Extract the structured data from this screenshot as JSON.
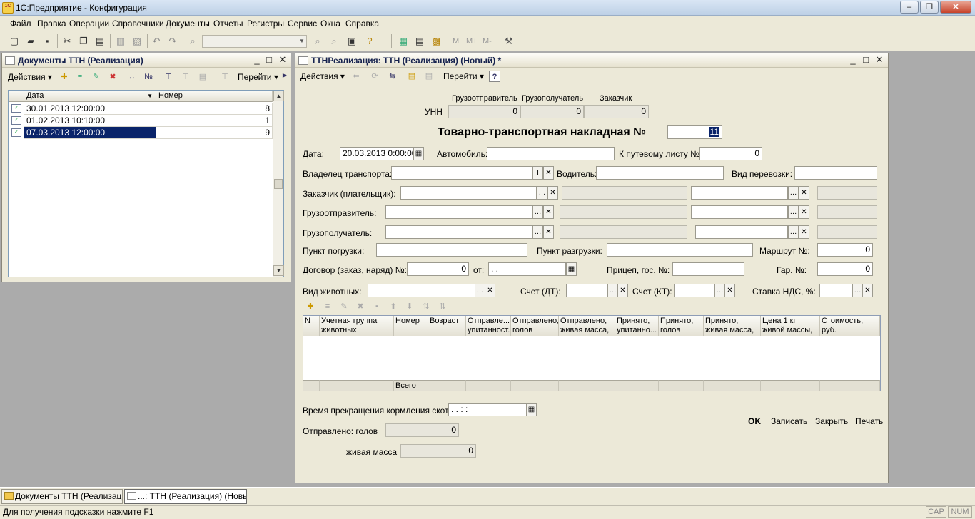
{
  "app": {
    "title": "1С:Предприятие - Конфигурация",
    "logo": "1C"
  },
  "window_controls": {
    "minimize": "–",
    "maximize": "❐",
    "close": "✕"
  },
  "menu": [
    "Файл",
    "Правка",
    "Операции",
    "Справочники",
    "Документы",
    "Отчеты",
    "Регистры",
    "Сервис",
    "Окна",
    "Справка"
  ],
  "toolbar": {
    "search_value": "",
    "right_labels": [
      "M",
      "M+",
      "M-"
    ]
  },
  "list_window": {
    "title": "Документы ТТН (Реализация)",
    "actions_label": "Действия",
    "goto_label": "Перейти",
    "columns": [
      "Дата",
      "Номер"
    ],
    "rows": [
      {
        "date": "30.01.2013 12:00:00",
        "number": "8"
      },
      {
        "date": "01.02.2013 10:10:00",
        "number": "1"
      },
      {
        "date": "07.03.2013 12:00:00",
        "number": "9"
      }
    ]
  },
  "form_window": {
    "title": "ТТНРеализация: ТТН (Реализация) (Новый) *",
    "actions_label": "Действия",
    "goto_label": "Перейти",
    "help_label": "?",
    "unn": {
      "label": "УНН",
      "headers": [
        "Грузоотправитель",
        "Грузополучатель",
        "Заказчик"
      ],
      "values": [
        "0",
        "0",
        "0"
      ]
    },
    "doc_title": "Товарно-транспортная накладная №",
    "doc_number": "11",
    "date_label": "Дата:",
    "date_value": "20.03.2013  0:00:00",
    "car_label": "Автомобиль:",
    "car_value": "",
    "waybill_label": "К путевому листу №:",
    "waybill_value": "0",
    "owner_label": "Владелец транспорта:",
    "owner_value": "",
    "owner_t": "T",
    "driver_label": "Водитель:",
    "driver_value": "",
    "transport_type_label": "Вид перевозки:",
    "transport_type_value": "",
    "customer_label": "Заказчик (плательщик):",
    "shipper_label": "Грузоотправитель:",
    "consignee_label": "Грузополучатель:",
    "loading_label": "Пункт погрузки:",
    "loading_value": "",
    "unloading_label": "Пункт разгрузки:",
    "unloading_value": "",
    "route_label": "Маршрут №:",
    "route_value": "0",
    "contract_label": "Договор (заказ, наряд) №:",
    "contract_value": "0",
    "from_label": "от:",
    "from_value": " .  .",
    "trailer_label": "Прицеп, гос. №:",
    "trailer_value": "",
    "gar_label": "Гар. №:",
    "gar_value": "0",
    "animal_label": "Вид животных:",
    "animal_value": "",
    "debit_label": "Счет (ДТ):",
    "debit_value": "",
    "credit_label": "Счет (КТ):",
    "credit_value": "",
    "vat_label": "Ставка НДС, %:",
    "vat_value": "",
    "table": {
      "columns": [
        "N",
        "Учетная группа животных",
        "Номер",
        "Возраст",
        "Отправле... упитанност...",
        "Отправлено, голов",
        "Отправлено, живая масса,",
        "Принято, упитанно...",
        "Принято, голов",
        "Принято, живая масса,",
        "Цена 1 кг живой массы,",
        "Стоимость, руб."
      ],
      "total_label": "Всего"
    },
    "stop_feeding_label": "Время прекращения кормления скота:",
    "stop_feeding_value": " .  .     :  :",
    "sent_heads_label": "Отправлено: голов",
    "sent_heads_value": "0",
    "live_mass_label": "живая масса",
    "live_mass_value": "0",
    "buttons": {
      "ok": "OK",
      "save": "Записать",
      "close": "Закрыть",
      "print": "Печать"
    }
  },
  "taskbar": [
    {
      "label": "Документы ТТН (Реализац..."
    },
    {
      "label": "...: ТТН (Реализация) (Новы..."
    }
  ],
  "status": {
    "hint": "Для получения подсказки нажмите F1",
    "cap": "CAP",
    "num": "NUM"
  }
}
